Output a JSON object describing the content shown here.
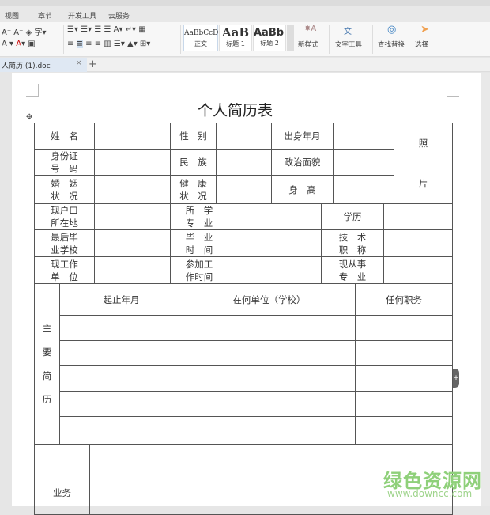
{
  "menu": {
    "tabs": [
      "视图",
      "章节",
      "开发工具",
      "云服务"
    ]
  },
  "ribbon": {
    "styles": [
      {
        "preview": "AaBbCcD",
        "label": "正文"
      },
      {
        "preview": "AaB",
        "label": "标题 1"
      },
      {
        "preview": "AaBb(",
        "label": "标题 2"
      }
    ],
    "new_style": "新样式",
    "text_tools": "文字工具",
    "find_replace": "查找替换",
    "select": "选择"
  },
  "tabbar": {
    "doc_tab": "人简历 (1).doc",
    "close": "×",
    "add": "+"
  },
  "document": {
    "title": "个人简历表",
    "labels": {
      "name": "姓　名",
      "gender": "性　别",
      "birth": "出身年月",
      "photo1": "照",
      "photo2": "片",
      "id": "身份证\n号　码",
      "ethnic": "民　族",
      "political": "政治面貌",
      "marital": "婚　姻\n状　况",
      "health": "健　康\n状　况",
      "height": "身　高",
      "hukou": "现户口\n所在地",
      "major": "所　学\n专　业",
      "education": "学历",
      "school": "最后毕\n业学校",
      "grad_time": "毕　业\n时　间",
      "title_rank": "技　术\n职　称",
      "workplace": "现工作\n单　位",
      "work_start": "参加工\n作时间",
      "profession": "现从事\n专　业",
      "resume": "主\n\n要\n\n简\n\n历",
      "period": "起止年月",
      "unit": "在何单位（学校）",
      "position": "任何职务",
      "business": "业务"
    }
  },
  "watermark": {
    "cn": "绿色资源网",
    "url": "www.downcc.com"
  }
}
